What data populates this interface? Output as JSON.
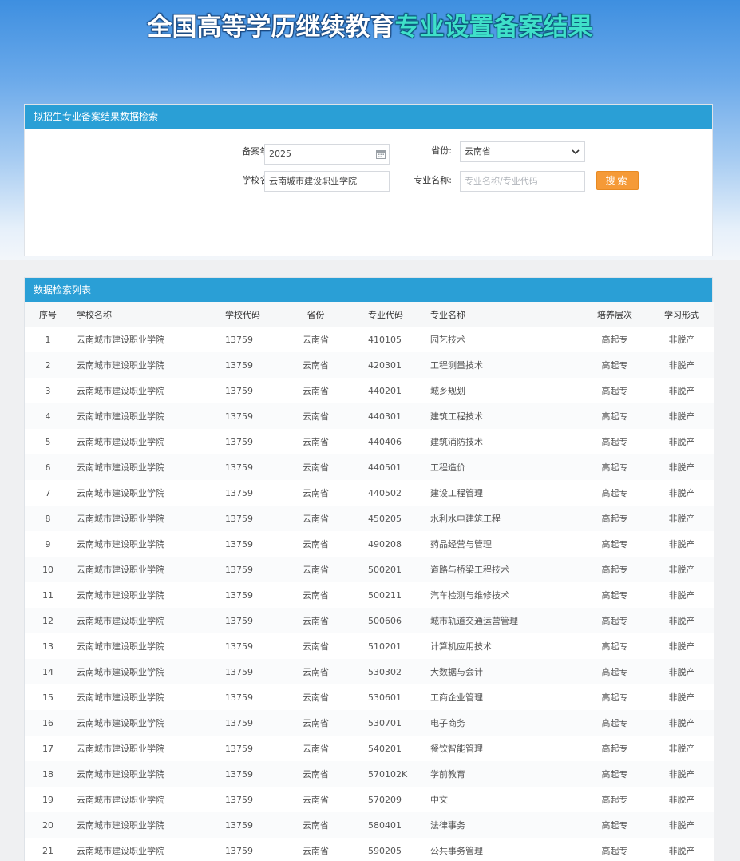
{
  "header": {
    "title_part1": "全国高等学历继续教育",
    "title_part2": "专业设置备案结果"
  },
  "search": {
    "panel_title": "拟招生专业备案结果数据检索",
    "year_label": "备案年份:",
    "year_value": "2025",
    "province_label": "省份:",
    "province_value": "云南省",
    "school_label": "学校名称:",
    "school_value": "云南城市建设职业学院",
    "major_label": "专业名称:",
    "major_placeholder": "专业名称/专业代码",
    "search_button": "搜索"
  },
  "list": {
    "panel_title": "数据检索列表",
    "columns": [
      "序号",
      "学校名称",
      "学校代码",
      "省份",
      "专业代码",
      "专业名称",
      "培养层次",
      "学习形式"
    ],
    "rows": [
      [
        "1",
        "云南城市建设职业学院",
        "13759",
        "云南省",
        "410105",
        "园艺技术",
        "高起专",
        "非脱产"
      ],
      [
        "2",
        "云南城市建设职业学院",
        "13759",
        "云南省",
        "420301",
        "工程测量技术",
        "高起专",
        "非脱产"
      ],
      [
        "3",
        "云南城市建设职业学院",
        "13759",
        "云南省",
        "440201",
        "城乡规划",
        "高起专",
        "非脱产"
      ],
      [
        "4",
        "云南城市建设职业学院",
        "13759",
        "云南省",
        "440301",
        "建筑工程技术",
        "高起专",
        "非脱产"
      ],
      [
        "5",
        "云南城市建设职业学院",
        "13759",
        "云南省",
        "440406",
        "建筑消防技术",
        "高起专",
        "非脱产"
      ],
      [
        "6",
        "云南城市建设职业学院",
        "13759",
        "云南省",
        "440501",
        "工程造价",
        "高起专",
        "非脱产"
      ],
      [
        "7",
        "云南城市建设职业学院",
        "13759",
        "云南省",
        "440502",
        "建设工程管理",
        "高起专",
        "非脱产"
      ],
      [
        "8",
        "云南城市建设职业学院",
        "13759",
        "云南省",
        "450205",
        "水利水电建筑工程",
        "高起专",
        "非脱产"
      ],
      [
        "9",
        "云南城市建设职业学院",
        "13759",
        "云南省",
        "490208",
        "药品经营与管理",
        "高起专",
        "非脱产"
      ],
      [
        "10",
        "云南城市建设职业学院",
        "13759",
        "云南省",
        "500201",
        "道路与桥梁工程技术",
        "高起专",
        "非脱产"
      ],
      [
        "11",
        "云南城市建设职业学院",
        "13759",
        "云南省",
        "500211",
        "汽车检测与维修技术",
        "高起专",
        "非脱产"
      ],
      [
        "12",
        "云南城市建设职业学院",
        "13759",
        "云南省",
        "500606",
        "城市轨道交通运营管理",
        "高起专",
        "非脱产"
      ],
      [
        "13",
        "云南城市建设职业学院",
        "13759",
        "云南省",
        "510201",
        "计算机应用技术",
        "高起专",
        "非脱产"
      ],
      [
        "14",
        "云南城市建设职业学院",
        "13759",
        "云南省",
        "530302",
        "大数据与会计",
        "高起专",
        "非脱产"
      ],
      [
        "15",
        "云南城市建设职业学院",
        "13759",
        "云南省",
        "530601",
        "工商企业管理",
        "高起专",
        "非脱产"
      ],
      [
        "16",
        "云南城市建设职业学院",
        "13759",
        "云南省",
        "530701",
        "电子商务",
        "高起专",
        "非脱产"
      ],
      [
        "17",
        "云南城市建设职业学院",
        "13759",
        "云南省",
        "540201",
        "餐饮智能管理",
        "高起专",
        "非脱产"
      ],
      [
        "18",
        "云南城市建设职业学院",
        "13759",
        "云南省",
        "570102K",
        "学前教育",
        "高起专",
        "非脱产"
      ],
      [
        "19",
        "云南城市建设职业学院",
        "13759",
        "云南省",
        "570209",
        "中文",
        "高起专",
        "非脱产"
      ],
      [
        "20",
        "云南城市建设职业学院",
        "13759",
        "云南省",
        "580401",
        "法律事务",
        "高起专",
        "非脱产"
      ],
      [
        "21",
        "云南城市建设职业学院",
        "13759",
        "云南省",
        "590205",
        "公共事务管理",
        "高起专",
        "非脱产"
      ]
    ]
  }
}
